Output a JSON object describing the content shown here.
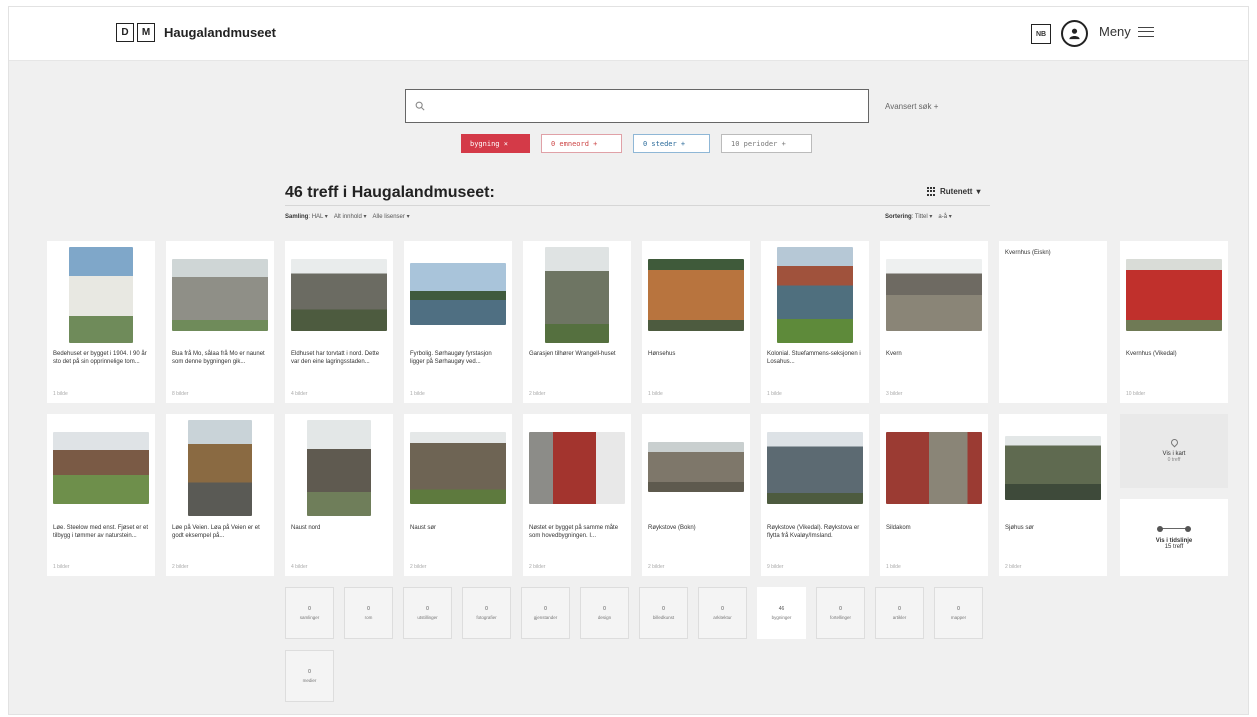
{
  "header": {
    "logo_letters": [
      "D",
      "M"
    ],
    "site_name": "Haugalandmuseet",
    "lang": "NB",
    "user_icon": "user-icon",
    "menu_label": "Meny",
    "menu_icon": "hamburger-icon"
  },
  "search": {
    "placeholder": "",
    "advanced_label": "Avansert søk +"
  },
  "filters": [
    {
      "label": "bygning ×",
      "style": "red"
    },
    {
      "label": "0 emneord +",
      "style": "pink"
    },
    {
      "label": "0 steder +",
      "style": "blue"
    },
    {
      "label": "10 perioder +",
      "style": "grey"
    }
  ],
  "results": {
    "title": "46 treff i Haugalandmuseet:",
    "view_label": "Rutenett",
    "collection_label": "Samling",
    "collection_value": "HAL",
    "content_filter": "Alt innhold",
    "license_filter": "Alle lisenser",
    "sort_label": "Sortering",
    "sort_field": "Tittel",
    "sort_order": "a-å"
  },
  "cards": [
    {
      "caption": "Bedehuset er bygget i 1904. I 90 år sto det på sin opprinnelige tom...",
      "meta": "1 bilde",
      "img_color": "#6f8b5a"
    },
    {
      "caption": "Bua frå Mo, sålaa frå Mo er naunet som denne bygningen gik...",
      "meta": "8 bilder",
      "img_color": "#8f8f87"
    },
    {
      "caption": "Eldhuset har torvtatt i nord. Dette var den eine lagringsstaden...",
      "meta": "4 bilder",
      "img_color": "#6b6b62"
    },
    {
      "caption": "Fyrbolig. Sørhaugøy fyrstasjon ligger på Sørhaugøy ved...",
      "meta": "1 bilde",
      "img_color": "#4f6f82"
    },
    {
      "caption": "Garasjen tilhører Wrangell-huset",
      "meta": "2 bilder",
      "img_color": "#6e7563"
    },
    {
      "caption": "Hønsehus",
      "meta": "1 bilde",
      "img_color": "#b8743e"
    },
    {
      "caption": "Kolonial. Stuefammens-seksjonen i Losahus...",
      "meta": "1 bilde",
      "img_color": "#4f6f7e"
    },
    {
      "caption": "Kvern",
      "meta": "3 bilder",
      "img_color": "#6e6a62"
    },
    {
      "caption": "Kvernhus (Eiskn)",
      "meta": "",
      "img_color": ""
    },
    {
      "caption": "Kvernhus (Vikedal)",
      "meta": "10 bilder",
      "img_color": "#c0302c"
    },
    {
      "caption": "Løe. Steelow med enst. Fjøset er et tilbygg i tømmer av naturstein...",
      "meta": "1 bilder",
      "img_color": "#7a5a45"
    },
    {
      "caption": "Løe på Veien. Løa på Veien er et godt eksempel på...",
      "meta": "2 bilder",
      "img_color": "#8a6a42"
    },
    {
      "caption": "Naust nord",
      "meta": "4 bilder",
      "img_color": "#5f5a50"
    },
    {
      "caption": "Naust sør",
      "meta": "2 bilder",
      "img_color": "#6e6454"
    },
    {
      "caption": "Nøstet er bygget på samme måte som hovedbygningen. I...",
      "meta": "2 bilder",
      "img_color": "#a3342e"
    },
    {
      "caption": "Røykstove (Bokn)",
      "meta": "2 bilder",
      "img_color": "#7e776a"
    },
    {
      "caption": "Røykstove (Vikedal). Røykstova er flytta frå Kvaløy/Imsland.",
      "meta": "9 bilder",
      "img_color": "#5c6a72"
    },
    {
      "caption": "Sildakom",
      "meta": "1 bilde",
      "img_color": "#9b3b33"
    },
    {
      "caption": "Sjøhus sør",
      "meta": "2 bilder",
      "img_color": "#5f6a50"
    }
  ],
  "side": {
    "map_label": "Vis i kart",
    "map_count": "0 treff",
    "map_icon": "map-pin-icon",
    "timeline_label": "Vis i tidslinje",
    "timeline_count": "15 treff",
    "timeline_icon": "timeline-icon"
  },
  "tiles": [
    {
      "count": "0",
      "label": "samlinger"
    },
    {
      "count": "0",
      "label": "rom"
    },
    {
      "count": "0",
      "label": "utstillinger"
    },
    {
      "count": "0",
      "label": "fotografier"
    },
    {
      "count": "0",
      "label": "gjenstander"
    },
    {
      "count": "0",
      "label": "design"
    },
    {
      "count": "0",
      "label": "billedkunst"
    },
    {
      "count": "0",
      "label": "arkitektur"
    },
    {
      "count": "46",
      "label": "bygninger"
    },
    {
      "count": "0",
      "label": "fortellinger"
    },
    {
      "count": "0",
      "label": "artikler"
    },
    {
      "count": "0",
      "label": "mapper"
    },
    {
      "count": "0",
      "label": "medier"
    }
  ]
}
